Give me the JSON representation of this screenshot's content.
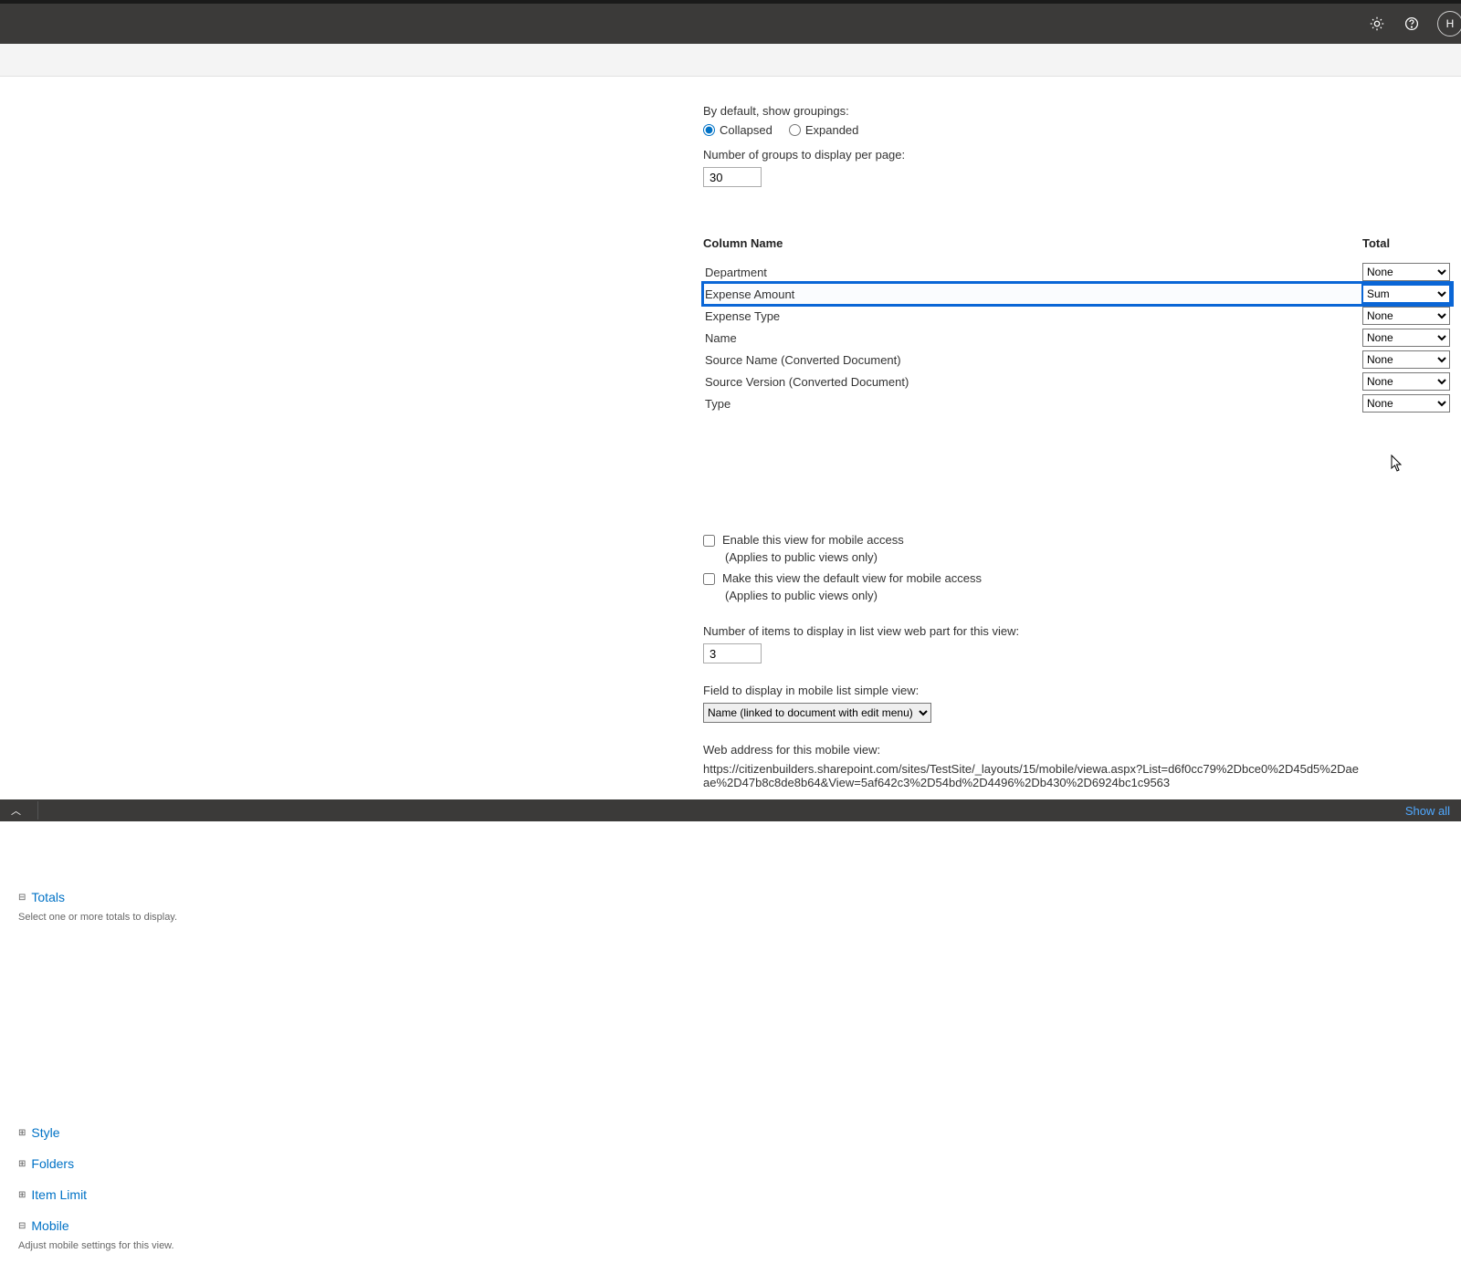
{
  "groupings": {
    "label": "By default, show groupings:",
    "collapsed_label": "Collapsed",
    "expanded_label": "Expanded",
    "per_page_label": "Number of groups to display per page:",
    "per_page_value": "30"
  },
  "totals_section": {
    "title": "Totals",
    "desc": "Select one or more totals to display.",
    "header_col": "Column Name",
    "header_total": "Total",
    "none_opt": "None",
    "sum_opt": "Sum",
    "rows": {
      "department": "Department",
      "expense_amount": "Expense Amount",
      "expense_type": "Expense Type",
      "name": "Name",
      "source_name": "Source Name (Converted Document)",
      "source_version": "Source Version (Converted Document)",
      "type": "Type"
    }
  },
  "sections": {
    "style": "Style",
    "folders": "Folders",
    "item_limit": "Item Limit",
    "mobile": "Mobile",
    "mobile_desc": "Adjust mobile settings for this view."
  },
  "mobile": {
    "enable_label": "Enable this view for mobile access",
    "applies_note": "(Applies to public views only)",
    "default_label": "Make this view the default view for mobile access",
    "items_label": "Number of items to display in list view web part for this view:",
    "items_value": "3",
    "field_label": "Field to display in mobile list simple view:",
    "field_value": "Name (linked to document with edit menu)",
    "url_label": "Web address for this mobile view:",
    "url_value": "https://citizenbuilders.sharepoint.com/sites/TestSite/_layouts/15/mobile/viewa.aspx?List=d6f0cc79%2Dbce0%2D45d5%2Daeae%2D47b8c8de8b64&View=5af642c3%2D54bd%2D4496%2Db430%2D6924bc1c9563"
  },
  "header": {
    "avatar_initial": "H"
  },
  "footer": {
    "show_all": "Show all"
  }
}
